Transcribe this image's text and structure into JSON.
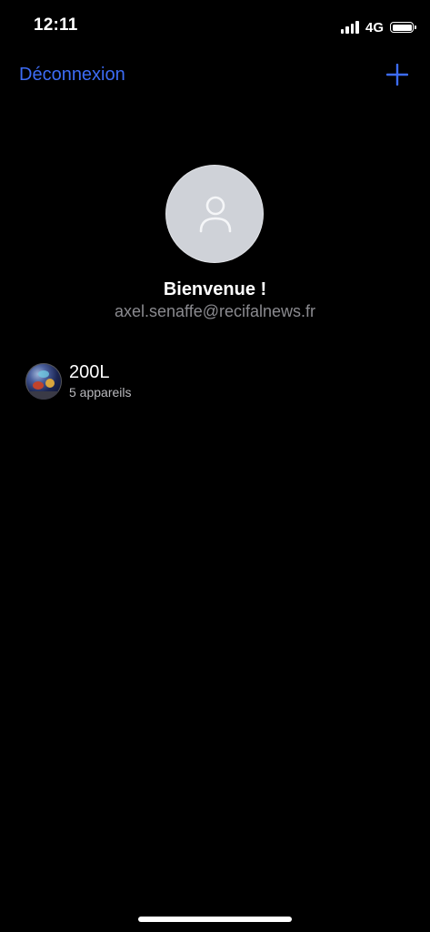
{
  "status_bar": {
    "time": "12:11",
    "network": "4G",
    "signal_icon": "cellular-signal-icon",
    "battery_icon": "battery-icon"
  },
  "nav": {
    "logout_label": "Déconnexion",
    "add_icon": "plus-icon",
    "accent_color": "#3d6cf5"
  },
  "profile": {
    "avatar_icon": "user-placeholder-icon",
    "welcome": "Bienvenue !",
    "email": "axel.senaffe@recifalnews.fr"
  },
  "tanks": [
    {
      "name": "200L",
      "subtitle": "5 appareils"
    }
  ]
}
